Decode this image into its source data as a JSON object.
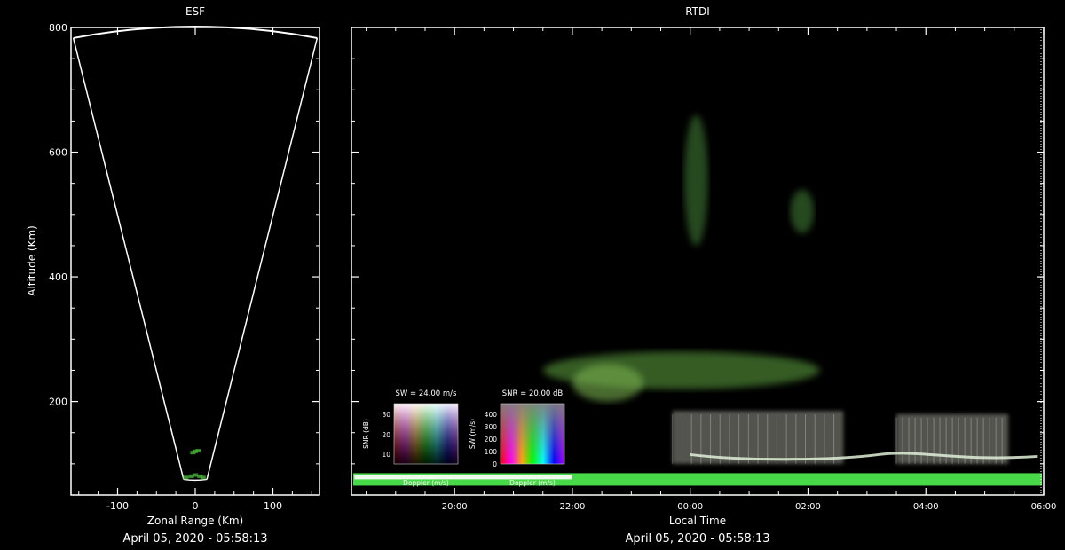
{
  "chart_data": [
    {
      "type": "scatter",
      "title": "ESF",
      "xlabel": "Zonal Range (Km)",
      "ylabel": "Altitude (Km)",
      "xlim": [
        -160,
        160
      ],
      "ylim": [
        50,
        800
      ],
      "xticks": [
        -100,
        0,
        100
      ],
      "yticks": [
        200,
        400,
        600,
        800
      ],
      "footer": "April 05, 2020 - 05:58:13",
      "fan": {
        "outline_color": "#ffffff",
        "left_edge": [
          [
            -157,
            783
          ],
          [
            -15,
            75
          ]
        ],
        "right_edge": [
          [
            157,
            783
          ],
          [
            15,
            75
          ]
        ]
      },
      "echo_color": "#44aa33",
      "echoes": [
        {
          "x": -5,
          "y": 80
        },
        {
          "x": 0,
          "y": 82
        },
        {
          "x": 6,
          "y": 80
        },
        {
          "x": -12,
          "y": 78
        },
        {
          "x": 10,
          "y": 78
        },
        {
          "x": 0,
          "y": 120
        },
        {
          "x": -3,
          "y": 118
        },
        {
          "x": 4,
          "y": 121
        }
      ]
    },
    {
      "type": "heatmap",
      "title": "RTDI",
      "xlabel": "Local Time",
      "ylabel": "",
      "xticks": [
        "20:00",
        "22:00",
        "00:00",
        "02:00",
        "04:00",
        "06:00"
      ],
      "xlim_hours": [
        18.25,
        30.0
      ],
      "ylim": [
        50,
        800
      ],
      "footer": "April 05, 2020 - 05:58:13",
      "colors": {
        "echo": "#5fbf3f",
        "bright_layer": "#e0f0d8",
        "band": "#55ff55",
        "white": "#ffffff"
      },
      "structures": [
        {
          "name": "plume-1",
          "t_start": 21.5,
          "t_end": 26.2,
          "alt_top": 280,
          "alt_bottom": 220,
          "color": "#5a9a3c"
        },
        {
          "name": "plume-2",
          "t_start": 22.0,
          "t_end": 23.2,
          "alt_top": 260,
          "alt_bottom": 200,
          "color": "#79b04f"
        },
        {
          "name": "plume-3",
          "t_start": 23.9,
          "t_end": 24.3,
          "alt_top": 660,
          "alt_bottom": 450,
          "color": "#3f7a35"
        },
        {
          "name": "plume-4",
          "t_start": 25.7,
          "t_end": 26.1,
          "alt_top": 540,
          "alt_bottom": 470,
          "color": "#3f7a35"
        },
        {
          "name": "column-1",
          "t_start": 23.7,
          "t_end": 26.6,
          "alt_top": 185,
          "alt_bottom": 100,
          "color": "#9a9a90"
        },
        {
          "name": "column-2",
          "t_start": 27.5,
          "t_end": 29.4,
          "alt_top": 180,
          "alt_bottom": 100,
          "color": "#9a9a90"
        }
      ],
      "ground_band": {
        "t_start": 18.25,
        "t_end": 30.0,
        "alt_top": 85,
        "alt_bottom": 65
      },
      "legends": [
        {
          "title": "SW = 24.00 m/s",
          "ylabel": "SNR (dB)",
          "xlabel": "Doppler (m/s)",
          "yticks": [
            "30",
            "20",
            "10"
          ]
        },
        {
          "title": "SNR = 20.00 dB",
          "ylabel": "SW (m/s)",
          "xlabel": "Doppler (m/s)",
          "yticks": [
            "400",
            "300",
            "200",
            "100",
            "0"
          ]
        }
      ]
    }
  ]
}
